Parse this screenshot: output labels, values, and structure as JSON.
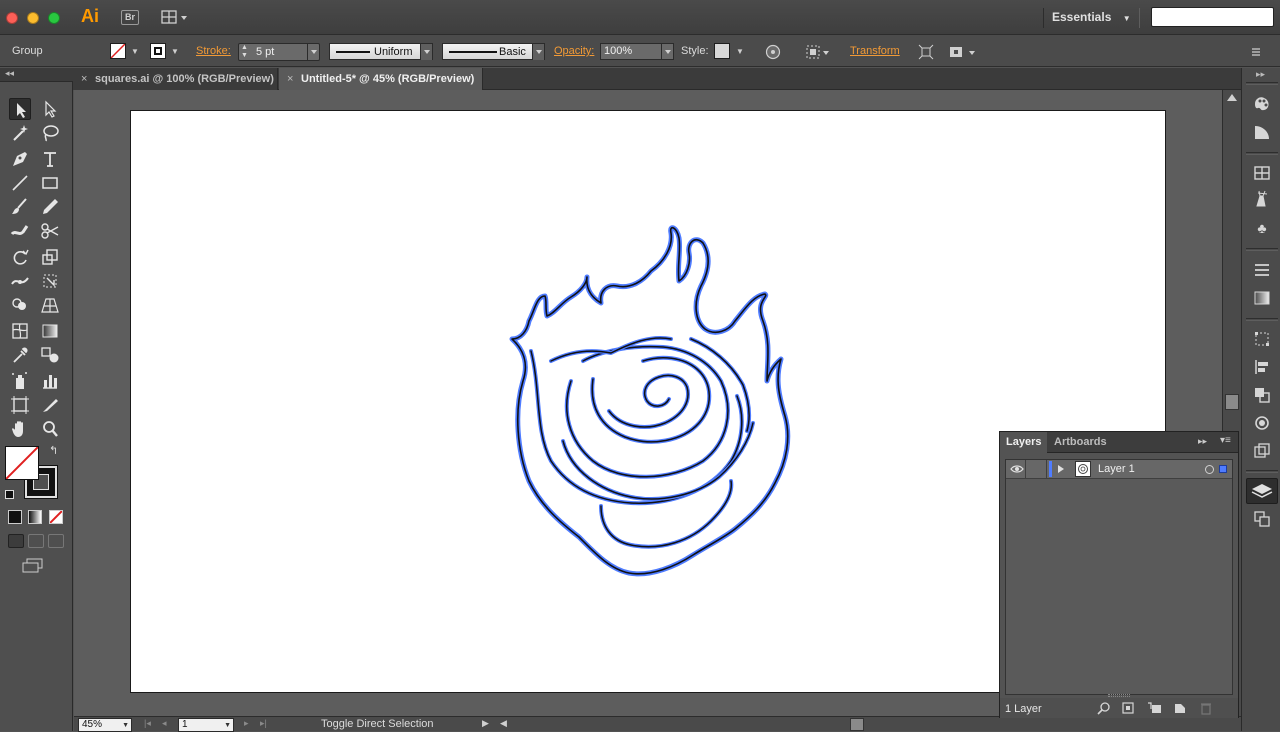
{
  "app": {
    "logo": "Ai",
    "bridge_label": "Br",
    "workspace": "Essentials",
    "search_value": ""
  },
  "control_bar": {
    "selection_type": "Group",
    "stroke_label": "Stroke:",
    "stroke_value": "5 pt",
    "profile_uniform": "Uniform",
    "brush_basic": "Basic",
    "opacity_label": "Opacity:",
    "opacity_value": "100%",
    "style_label": "Style:",
    "transform_label": "Transform"
  },
  "tabs": [
    {
      "label": "squares.ai @ 100% (RGB/Preview)",
      "active": false
    },
    {
      "label": "Untitled-5* @ 45% (RGB/Preview)",
      "active": true
    }
  ],
  "tools": [
    "selection-tool",
    "direct-selection-tool",
    "magic-wand-tool",
    "lasso-tool",
    "pen-tool",
    "type-tool",
    "line-segment-tool",
    "rectangle-tool",
    "paintbrush-tool",
    "pencil-tool",
    "blob-brush-tool",
    "scissors-tool",
    "rotate-tool",
    "scale-tool",
    "width-tool",
    "free-transform-tool",
    "shape-builder-tool",
    "perspective-grid-tool",
    "mesh-tool",
    "gradient-tool",
    "eyedropper-tool",
    "blend-tool",
    "symbol-sprayer-tool",
    "column-graph-tool",
    "artboard-tool",
    "slice-tool",
    "hand-tool",
    "zoom-tool"
  ],
  "status_bar": {
    "zoom": "45%",
    "artboard_number": "1",
    "status_text": "Toggle Direct Selection"
  },
  "layers_panel": {
    "tab_layers": "Layers",
    "tab_artboards": "Artboards",
    "layers": [
      {
        "name": "Layer 1",
        "color": "#4f7cff"
      }
    ],
    "footer_count": "1 Layer"
  },
  "colors": {
    "accent_orange": "#f29a36",
    "path_blue": "#4f7cff",
    "artboard": "#ffffff"
  }
}
